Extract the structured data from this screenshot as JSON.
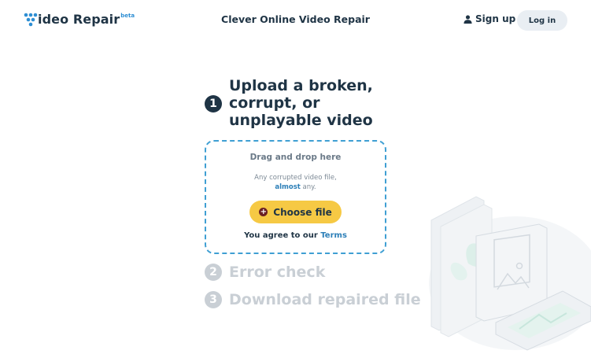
{
  "header": {
    "logo_text": "ideo Repair",
    "logo_beta": "beta",
    "center_title": "Clever Online Video Repair",
    "signup_label": "Sign up",
    "login_label": "Log in"
  },
  "steps": [
    {
      "number": "1",
      "title": "Upload a broken, corrupt, or unplayable video"
    },
    {
      "number": "2",
      "title": "Error check"
    },
    {
      "number": "3",
      "title": "Download repaired file"
    }
  ],
  "dropzone": {
    "title": "Drag and drop here",
    "desc_line1": "Any corrupted video file,",
    "desc_almost": "almost",
    "desc_rest": " any.",
    "choose_label": "Choose file",
    "agree_text": "You agree to our ",
    "terms_label": "Terms"
  },
  "colors": {
    "primary": "#1f3445",
    "accent_blue": "#3f9fd3",
    "button_yellow": "#f6c944",
    "muted": "#c9cfd5"
  },
  "icons": {
    "logo": "logo-dots-icon",
    "user": "user-icon",
    "plus": "plus-circle-icon"
  }
}
